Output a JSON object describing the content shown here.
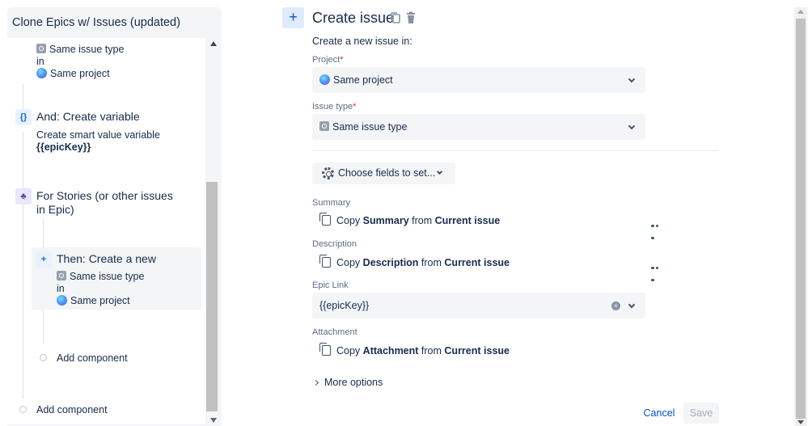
{
  "left_panel": {
    "title": "Clone Epics w/ Issues (updated)",
    "top_issue_type": "Same issue type",
    "top_in": "in",
    "top_project": "Same project",
    "and_node": {
      "icon": "{}",
      "title": "And: Create variable",
      "desc": "Create smart value variable",
      "var": "{{epicKey}}"
    },
    "for_node": {
      "title_line1": "For Stories (or other issues",
      "title_line2": "in Epic)"
    },
    "then_node": {
      "icon": "+",
      "title": "Then: Create a new",
      "issue_type": "Same issue type",
      "in": "in",
      "project": "Same project"
    },
    "add_component_inner": "Add component",
    "add_component_outer": "Add component"
  },
  "editor": {
    "plus_icon": "+",
    "title": "Create issue",
    "subtitle": "Create a new issue in:",
    "project": {
      "label": "Project",
      "required": "*",
      "value": "Same project"
    },
    "issue_type": {
      "label": "Issue type",
      "required": "*",
      "value": "Same issue type"
    },
    "choose_fields": "Choose fields to set...",
    "summary": {
      "label": "Summary",
      "copy": "Copy",
      "field": "Summary",
      "from": "from",
      "source": "Current issue"
    },
    "description": {
      "label": "Description",
      "copy": "Copy",
      "field": "Description",
      "from": "from",
      "source": "Current issue"
    },
    "epic_link": {
      "label": "Epic Link",
      "value": "{{epicKey}}",
      "clear": "×"
    },
    "attachment": {
      "label": "Attachment",
      "copy": "Copy",
      "field": "Attachment",
      "from": "from",
      "source": "Current issue"
    },
    "more_options": "More options",
    "cancel": "Cancel",
    "save": "Save"
  },
  "colors": {
    "accent": "#0052cc",
    "panel_bg": "#f4f5f7",
    "required": "#de350b"
  }
}
